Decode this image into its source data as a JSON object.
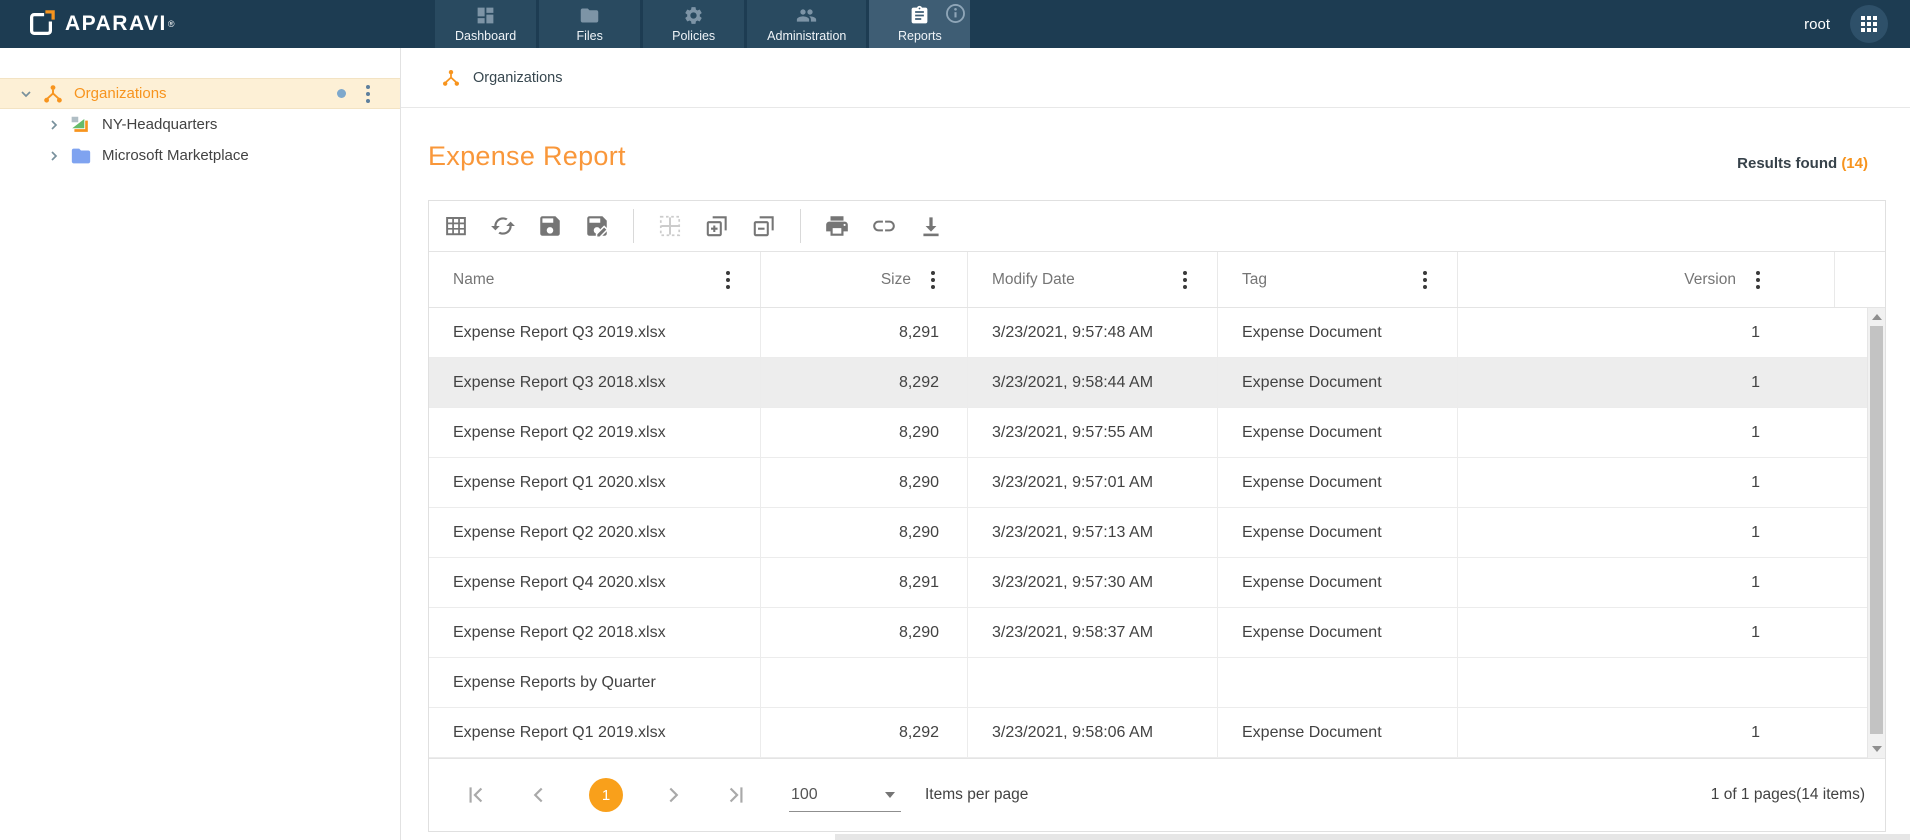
{
  "header": {
    "logo_text": "APARAVI",
    "logo_reg": "®",
    "user": "root",
    "tabs": [
      {
        "label": "Dashboard",
        "icon": "dashboard-icon",
        "selected": false
      },
      {
        "label": "Files",
        "icon": "folder-icon",
        "selected": false
      },
      {
        "label": "Policies",
        "icon": "gear-icon",
        "selected": false
      },
      {
        "label": "Administration",
        "icon": "people-icon",
        "selected": false
      },
      {
        "label": "Reports",
        "icon": "clipboard-icon",
        "selected": true
      }
    ]
  },
  "sidebar": {
    "items": [
      {
        "label": "Organizations",
        "icon": "organization-icon",
        "selected": true,
        "expanded": true
      },
      {
        "label": "NY-Headquarters",
        "icon": "collector-icon",
        "selected": false,
        "expanded": false
      },
      {
        "label": "Microsoft Marketplace",
        "icon": "folder-icon",
        "selected": false,
        "expanded": false
      }
    ]
  },
  "breadcrumb": {
    "label": "Organizations"
  },
  "main": {
    "title": "Expense Report",
    "results_label": "Results found",
    "results_count": "(14)"
  },
  "toolbar": {
    "buttons": [
      "table-columns",
      "refresh",
      "save",
      "save-as",
      "select-cells",
      "expand-all",
      "collapse-all",
      "print",
      "link",
      "download"
    ]
  },
  "table": {
    "columns": [
      "Name",
      "Size",
      "Modify Date",
      "Tag",
      "Version"
    ],
    "rows": [
      {
        "name": "Expense Report Q3 2019.xlsx",
        "size": "8,291",
        "modify_date": "3/23/2021, 9:57:48 AM",
        "tag": "Expense Document",
        "version": "1",
        "highlighted": false
      },
      {
        "name": "Expense Report Q3 2018.xlsx",
        "size": "8,292",
        "modify_date": "3/23/2021, 9:58:44 AM",
        "tag": "Expense Document",
        "version": "1",
        "highlighted": true
      },
      {
        "name": "Expense Report Q2 2019.xlsx",
        "size": "8,290",
        "modify_date": "3/23/2021, 9:57:55 AM",
        "tag": "Expense Document",
        "version": "1",
        "highlighted": false
      },
      {
        "name": "Expense Report Q1 2020.xlsx",
        "size": "8,290",
        "modify_date": "3/23/2021, 9:57:01 AM",
        "tag": "Expense Document",
        "version": "1",
        "highlighted": false
      },
      {
        "name": "Expense Report Q2 2020.xlsx",
        "size": "8,290",
        "modify_date": "3/23/2021, 9:57:13 AM",
        "tag": "Expense Document",
        "version": "1",
        "highlighted": false
      },
      {
        "name": "Expense Report Q4 2020.xlsx",
        "size": "8,291",
        "modify_date": "3/23/2021, 9:57:30 AM",
        "tag": "Expense Document",
        "version": "1",
        "highlighted": false
      },
      {
        "name": "Expense Report Q2 2018.xlsx",
        "size": "8,290",
        "modify_date": "3/23/2021, 9:58:37 AM",
        "tag": "Expense Document",
        "version": "1",
        "highlighted": false
      },
      {
        "name": "Expense Reports by Quarter",
        "size": "",
        "modify_date": "",
        "tag": "",
        "version": "",
        "highlighted": false
      },
      {
        "name": "Expense Report Q1 2019.xlsx",
        "size": "8,292",
        "modify_date": "3/23/2021, 9:58:06 AM",
        "tag": "Expense Document",
        "version": "1",
        "highlighted": false
      }
    ]
  },
  "pagination": {
    "current_page": "1",
    "page_size": "100",
    "items_per_page_label": "Items per page",
    "summary": "1 of 1 pages(14 items)"
  },
  "colors": {
    "header_bg": "#1d3c52",
    "tab_selected_bg": "#3e5d74",
    "accent_orange": "#f7941e",
    "sidebar_selected_bg": "#fdf0d6",
    "row_highlight": "#ededed"
  }
}
